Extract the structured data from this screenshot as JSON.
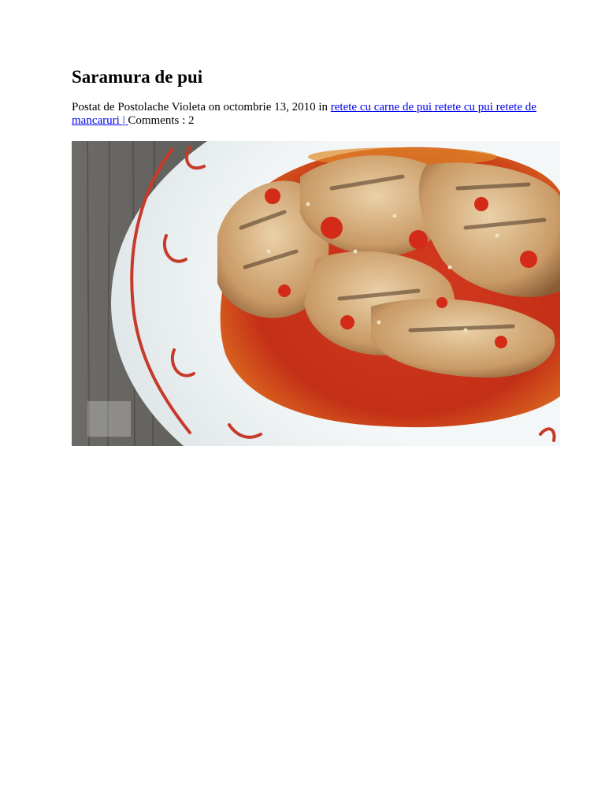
{
  "post": {
    "title": "Saramura de pui",
    "meta_prefix": "Postat de Postolache Violeta on octombrie 13, 2010 in ",
    "categories": [
      "retete cu carne de pui retete cu pui ",
      "retete de mancaruri "
    ],
    "separator": "| ",
    "comments_label": "Comments : 2"
  },
  "photo": {
    "subject": "chicken-in-tomato-brine-on-white-plate",
    "colors": {
      "wood": "#5f5d59",
      "plate": "#f2f5f5",
      "rim": "#c63a2a",
      "sauce": "#c8321c",
      "chicken": "#d8b68a"
    }
  }
}
